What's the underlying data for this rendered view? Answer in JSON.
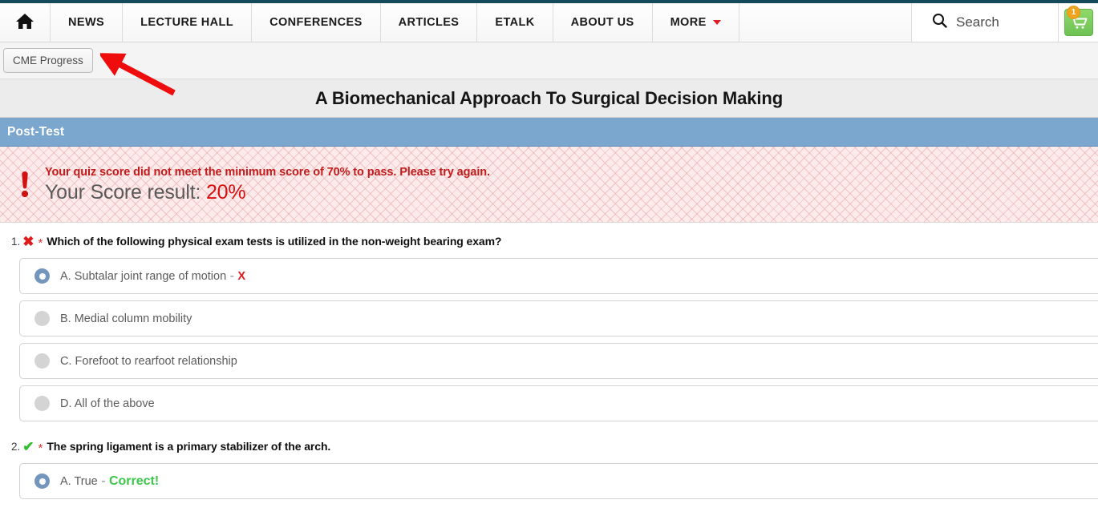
{
  "navbar": {
    "home_icon": "home-icon",
    "items": [
      {
        "label": "NEWS",
        "has_caret": false
      },
      {
        "label": "LECTURE HALL",
        "has_caret": false
      },
      {
        "label": "CONFERENCES",
        "has_caret": false
      },
      {
        "label": "ARTICLES",
        "has_caret": false
      },
      {
        "label": "ETALK",
        "has_caret": false
      },
      {
        "label": "ABOUT US",
        "has_caret": false
      },
      {
        "label": "MORE",
        "has_caret": true
      }
    ],
    "search": {
      "icon": "search-icon",
      "placeholder": "Search",
      "value": "Search"
    },
    "cart": {
      "icon": "shopping-cart-icon",
      "badge_count": "1",
      "color": "#6ec254",
      "badge_color": "#f0a41e"
    }
  },
  "subbar": {
    "cme_progress_label": "CME Progress",
    "annotation_arrow": "red-arrow-annotation"
  },
  "course": {
    "title": "A Biomechanical Approach To Surgical Decision Making"
  },
  "section": {
    "label": "Post-Test",
    "color": "#7ba6ce"
  },
  "alert": {
    "icon": "exclamation-icon",
    "message": "Your quiz score did not meet the minimum score of 70% to pass. Please try again.",
    "score_label": "Your Score result:",
    "score_value": "20%",
    "message_color": "#c21b1b",
    "score_color": "#d80f0f",
    "passing_score": "70%"
  },
  "questions": [
    {
      "number": "1.",
      "result_icon": "x-mark-icon",
      "result": "wrong",
      "result_glyph": "✖",
      "required_marker": "*",
      "text": "Which of the following physical exam tests is utilized in the non-weight bearing exam?",
      "answers": [
        {
          "label": "A. Subtalar joint range of motion",
          "selected": true,
          "feedback": "X",
          "feedback_kind": "wrong"
        },
        {
          "label": "B. Medial column mobility",
          "selected": false,
          "feedback": "",
          "feedback_kind": ""
        },
        {
          "label": "C. Forefoot to rearfoot relationship",
          "selected": false,
          "feedback": "",
          "feedback_kind": ""
        },
        {
          "label": "D. All of the above",
          "selected": false,
          "feedback": "",
          "feedback_kind": ""
        }
      ]
    },
    {
      "number": "2.",
      "result_icon": "check-mark-icon",
      "result": "right",
      "result_glyph": "✔",
      "required_marker": "*",
      "text": "The spring ligament is a primary stabilizer of the arch.",
      "answers": [
        {
          "label": "A. True",
          "selected": true,
          "feedback": "Correct!",
          "feedback_kind": "correct"
        }
      ]
    }
  ]
}
